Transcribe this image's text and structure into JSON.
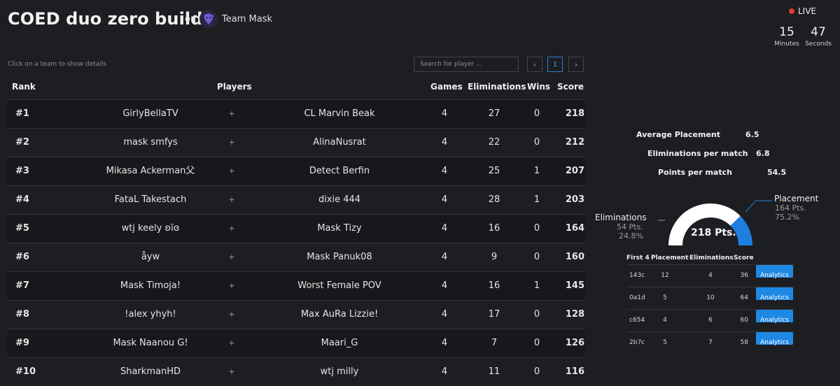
{
  "header": {
    "title": "COED duo zero build",
    "on_label": "on",
    "team_name": "Team Mask"
  },
  "live": {
    "label": "LIVE",
    "minutes": "15",
    "minutes_label": "Minutes",
    "seconds": "47",
    "seconds_label": "Seconds"
  },
  "toolbar": {
    "hint": "Click on a team to show details",
    "search_placeholder": "Search for player ...",
    "prev": "‹",
    "page": "1",
    "next": "›"
  },
  "table": {
    "columns": {
      "rank": "Rank",
      "players": "Players",
      "games": "Games",
      "eliminations": "Eliminations",
      "wins": "Wins",
      "score": "Score"
    },
    "rows": [
      {
        "rank": "#1",
        "p1": "GirlyBellaTV",
        "plus": "+",
        "p2": "CL Marvin Beak",
        "games": "4",
        "elims": "27",
        "wins": "0",
        "score": "218"
      },
      {
        "rank": "#2",
        "p1": "mask smfys",
        "plus": "+",
        "p2": "AlinaNusrat",
        "games": "4",
        "elims": "22",
        "wins": "0",
        "score": "212"
      },
      {
        "rank": "#3",
        "p1": "Mikasa Ackerman父",
        "plus": "+",
        "p2": "Detect Berfin",
        "games": "4",
        "elims": "25",
        "wins": "1",
        "score": "207"
      },
      {
        "rank": "#4",
        "p1": "FataL Takestach",
        "plus": "+",
        "p2": "dixie 444",
        "games": "4",
        "elims": "28",
        "wins": "1",
        "score": "203"
      },
      {
        "rank": "#5",
        "p1": "wtj keely ʚïɞ",
        "plus": "+",
        "p2": "Mask Tizy",
        "games": "4",
        "elims": "16",
        "wins": "0",
        "score": "164"
      },
      {
        "rank": "#6",
        "p1": "åyw",
        "plus": "+",
        "p2": "Mask Panuk08",
        "games": "4",
        "elims": "9",
        "wins": "0",
        "score": "160"
      },
      {
        "rank": "#7",
        "p1": "Mask Timoja!",
        "plus": "+",
        "p2": "Worst Female POV",
        "games": "4",
        "elims": "16",
        "wins": "1",
        "score": "145"
      },
      {
        "rank": "#8",
        "p1": "!alex yhyh!",
        "plus": "+",
        "p2": "Max AuRa Lizzie!",
        "games": "4",
        "elims": "17",
        "wins": "0",
        "score": "128"
      },
      {
        "rank": "#9",
        "p1": "Mask Naanou G!",
        "plus": "+",
        "p2": "Maari_G",
        "games": "4",
        "elims": "7",
        "wins": "0",
        "score": "126"
      },
      {
        "rank": "#10",
        "p1": "SharkmanHD",
        "plus": "+",
        "p2": "wtj milly",
        "games": "4",
        "elims": "11",
        "wins": "0",
        "score": "116"
      }
    ]
  },
  "details": {
    "avg_placement_label": "Average Placement",
    "avg_placement": "6.5",
    "elims_per_match_label": "Eliminations per match",
    "elims_per_match": "6.8",
    "points_per_match_label": "Points per match",
    "points_per_match": "54.5",
    "gauge": {
      "total": "218 Pts.",
      "elims_label": "Eliminations",
      "elims_pts": "54 Pts.",
      "elims_pct": "24.8%",
      "placement_label": "Placement",
      "placement_pts": "164 Pts.",
      "placement_pct": "75.2%",
      "placement_fraction": 0.752,
      "color_placement": "#1e7fe0",
      "color_elims": "#ffffff"
    },
    "matches": {
      "columns": {
        "game": "First 4",
        "placement": "Placement",
        "eliminations": "Eliminations",
        "score": "Score"
      },
      "rows": [
        {
          "game": "143c",
          "placement": "12",
          "eliminations": "4",
          "score": "36",
          "action": "Analytics"
        },
        {
          "game": "0a1d",
          "placement": "5",
          "eliminations": "10",
          "score": "64",
          "action": "Analytics"
        },
        {
          "game": "c654",
          "placement": "4",
          "eliminations": "6",
          "score": "60",
          "action": "Analytics"
        },
        {
          "game": "2b7c",
          "placement": "5",
          "eliminations": "7",
          "score": "58",
          "action": "Analytics"
        }
      ]
    }
  }
}
